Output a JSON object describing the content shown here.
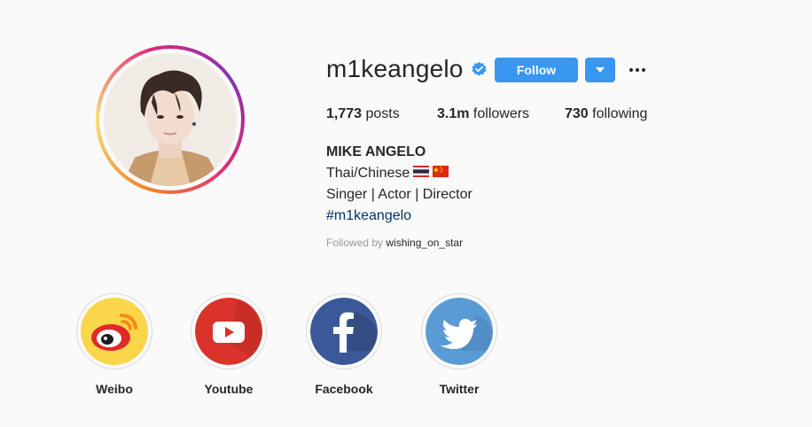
{
  "profile": {
    "username": "m1keangelo",
    "verified": true,
    "follow_label": "Follow",
    "stats": {
      "posts_count": "1,773",
      "posts_label": " posts",
      "followers_count": "3.1m",
      "followers_label": " followers",
      "following_count": "730",
      "following_label": " following"
    },
    "bio": {
      "name": "MIKE ANGELO",
      "line1": "Thai/Chinese",
      "line1_icons": [
        "thailand-flag-icon",
        "china-flag-icon"
      ],
      "line2": "Singer | Actor | Director",
      "hashtag": "#m1keangelo"
    },
    "followed_by_label": "Followed by ",
    "followed_by_user": "wishing_on_star"
  },
  "highlights": [
    {
      "label": "Weibo",
      "icon": "weibo-icon"
    },
    {
      "label": "Youtube",
      "icon": "youtube-icon"
    },
    {
      "label": "Facebook",
      "icon": "facebook-icon"
    },
    {
      "label": "Twitter",
      "icon": "twitter-icon"
    }
  ],
  "colors": {
    "background": "#fafafa",
    "follow_button": "#3897f0",
    "verified_badge": "#3897f0",
    "hashtag": "#003569",
    "muted_text": "#999999",
    "weibo": "#fbd54a",
    "youtube": "#d9332b",
    "facebook": "#3b5998",
    "twitter": "#5b9bd5"
  }
}
